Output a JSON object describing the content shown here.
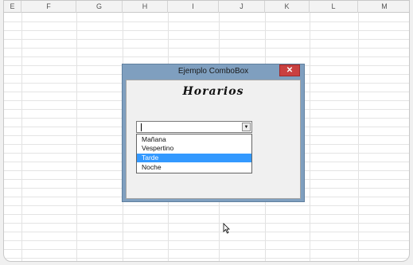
{
  "sheet": {
    "columns": [
      "E",
      "F",
      "G",
      "H",
      "I",
      "J",
      "K",
      "L",
      "M"
    ]
  },
  "dialog": {
    "title": "Ejemplo ComboBox",
    "close_label": "✕",
    "heading": "Horarios",
    "combo": {
      "value": "",
      "arrow_icon": "dropdown-arrow-icon"
    },
    "options": [
      "Mañana",
      "Vespertino",
      "Tarde",
      "Noche"
    ],
    "selected_option": "Tarde"
  },
  "colors": {
    "dialog_frame": "#7f9fbf",
    "close_button": "#c94040",
    "selection": "#3399ff"
  }
}
